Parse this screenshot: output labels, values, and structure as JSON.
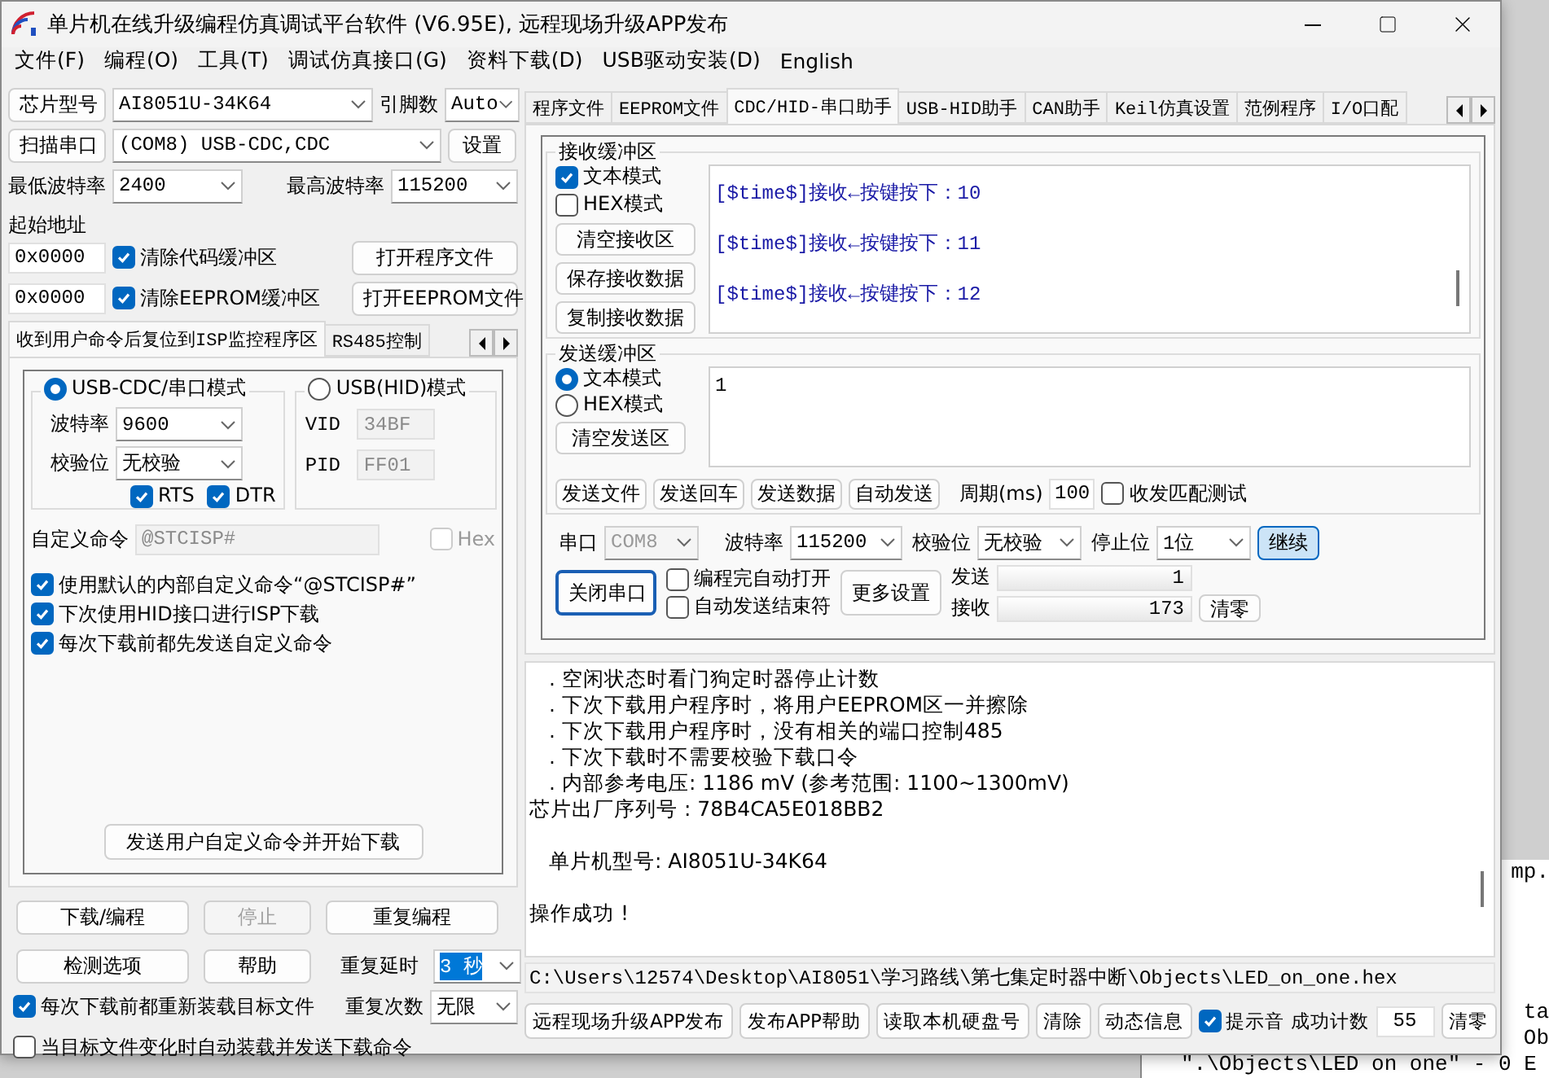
{
  "window": {
    "title": "单片机在线升级编程仿真调试平台软件 (V6.95E), 远程现场升级APP发布"
  },
  "menu": [
    "文件(F)",
    "编程(O)",
    "工具(T)",
    "调试仿真接口(G)",
    "资料下载(D)",
    "USB驱动安装(D)",
    "English"
  ],
  "chip": {
    "button": "芯片型号",
    "model": "AI8051U-34K64",
    "pins_label": "引脚数",
    "pins": "Auto"
  },
  "port": {
    "button": "扫描串口",
    "value": "(COM8) USB-CDC,CDC",
    "settings": "设置"
  },
  "baud": {
    "min_label": "最低波特率",
    "min": "2400",
    "max_label": "最高波特率",
    "max": "115200"
  },
  "address": {
    "label": "起始地址",
    "rows": [
      {
        "value": "0x0000",
        "option": "清除代码缓冲区",
        "checked": true,
        "button": "打开程序文件"
      },
      {
        "value": "0x0000",
        "option": "清除EEPROM缓冲区",
        "checked": true,
        "button": "打开EEPROM文件"
      }
    ]
  },
  "left_tabs": [
    {
      "label": "收到用户命令后复位到ISP监控程序区",
      "selected": true
    },
    {
      "label": "RS485控制",
      "selected": false
    }
  ],
  "cdc_mode": {
    "label": "USB-CDC/串口模式",
    "selected": true,
    "baud_label": "波特率",
    "baud": "9600",
    "parity_label": "校验位",
    "parity": "无校验",
    "lines": [
      {
        "label": "RTS",
        "checked": true
      },
      {
        "label": "DTR",
        "checked": true
      }
    ]
  },
  "hid_mode": {
    "label": "USB(HID)模式",
    "selected": false,
    "fields": [
      {
        "label": "VID",
        "value": "34BF"
      },
      {
        "label": "PID",
        "value": "FF01"
      }
    ]
  },
  "custom_command": {
    "label": "自定义命令",
    "value": "@STCISP#",
    "disabled": true,
    "hex": {
      "label": "Hex",
      "checked": false,
      "disabled": true
    }
  },
  "command_options": [
    {
      "label": "使用默认的内部自定义命令“@STCISP#”",
      "checked": true
    },
    {
      "label": "下次使用HID接口进行ISP下载",
      "checked": true
    },
    {
      "label": "每次下载前都先发送自定义命令",
      "checked": true
    }
  ],
  "send_command_button": "发送用户自定义命令并开始下载",
  "actions": [
    {
      "label": "下载/编程",
      "disabled": false
    },
    {
      "label": "停止",
      "disabled": true
    },
    {
      "label": "重复编程",
      "disabled": false
    }
  ],
  "help_row": {
    "buttons": [
      "检测选项",
      "帮助"
    ],
    "delay_label": "重复延时",
    "delay": {
      "value": "3 秒",
      "highlighted": true
    },
    "count_label": "重复次数",
    "count": "无限"
  },
  "reload_options": [
    {
      "label": "每次下载前都重新装载目标文件",
      "checked": true
    },
    {
      "label": "当目标文件变化时自动装载并发送下载命令",
      "checked": false
    }
  ],
  "right_tabs": [
    {
      "label": "程序文件",
      "selected": false
    },
    {
      "label": "EEPROM文件",
      "selected": false
    },
    {
      "label": "CDC/HID-串口助手",
      "selected": true
    },
    {
      "label": "USB-HID助手",
      "selected": false
    },
    {
      "label": "CAN助手",
      "selected": false
    },
    {
      "label": "Keil仿真设置",
      "selected": false
    },
    {
      "label": "范例程序",
      "selected": false
    },
    {
      "label": "I/O口配",
      "selected": false
    }
  ],
  "receive": {
    "title": "接收缓冲区",
    "modes": [
      {
        "label": "文本模式",
        "checked": true
      },
      {
        "label": "HEX模式",
        "checked": false
      }
    ],
    "buttons": [
      "清空接收区",
      "保存接收数据",
      "复制接收数据"
    ],
    "lines": [
      "[$time$]接收←按键按下：10",
      "[$time$]接收←按键按下：11",
      "[$time$]接收←按键按下：12"
    ]
  },
  "send": {
    "title": "发送缓冲区",
    "modes": [
      {
        "label": "文本模式",
        "selected": true
      },
      {
        "label": "HEX模式",
        "selected": false
      }
    ],
    "clear": "清空发送区",
    "value": "1",
    "buttons": [
      "发送文件",
      "发送回车",
      "发送数据",
      "自动发送"
    ],
    "period_label": "周期(ms)",
    "period": "100",
    "match": {
      "label": "收发匹配测试",
      "checked": false
    }
  },
  "serial": {
    "port_label": "串口",
    "port": "COM8",
    "port_disabled": true,
    "baud_label": "波特率",
    "baud": "115200",
    "parity_label": "校验位",
    "parity": "无校验",
    "stop_label": "停止位",
    "stop": "1位",
    "continue": {
      "label": "继续",
      "default": true
    }
  },
  "serial_actions": {
    "close": {
      "label": "关闭串口",
      "focused": true
    },
    "options": [
      {
        "label": "编程完自动打开",
        "checked": false
      },
      {
        "label": "自动发送结束符",
        "checked": false
      }
    ],
    "more": "更多设置",
    "counters": [
      {
        "label": "发送",
        "value": "1"
      },
      {
        "label": "接收",
        "value": "173"
      }
    ],
    "reset": "清零"
  },
  "log": [
    {
      "kind": "bullet",
      "text": ". 空闲状态时看门狗定时器停止计数"
    },
    {
      "kind": "bullet",
      "text": ". 下次下载用户程序时，将用户EEPROM区一并擦除"
    },
    {
      "kind": "bullet",
      "text": ". 下次下载用户程序时，没有相关的端口控制485"
    },
    {
      "kind": "bullet",
      "text": ". 下次下载时不需要校验下载口令"
    },
    {
      "kind": "bullet",
      "text": ". 内部参考电压: 1186 mV (参考范围: 1100~1300mV)"
    },
    {
      "kind": "heading",
      "text": "芯片出厂序列号 : 78B4CA5E018BB2"
    },
    {
      "kind": "note",
      "text": "单片机型号: AI8051U-34K64"
    },
    {
      "kind": "result",
      "text": "操作成功 !"
    }
  ],
  "path": "C:\\Users\\12574\\Desktop\\AI8051\\学习路线\\第七集定时器中断\\Objects\\LED_on_one.hex",
  "footer": {
    "buttons": [
      "远程现场升级APP发布",
      "发布APP帮助",
      "读取本机硬盘号",
      "清除",
      "动态信息"
    ],
    "sound": {
      "label": "提示音",
      "checked": true
    },
    "count_label": "成功计数",
    "count": "55",
    "reset": "清零"
  },
  "background_window": {
    "lines": [
      {
        "kind": "fragment",
        "text": "mp."
      },
      {
        "kind": "fragment",
        "text": "ta"
      },
      {
        "kind": "fragment",
        "text": "Ob"
      },
      {
        "kind": "line",
        "text": "\".\\Objects\\LED on one\" - 0 E"
      }
    ]
  }
}
